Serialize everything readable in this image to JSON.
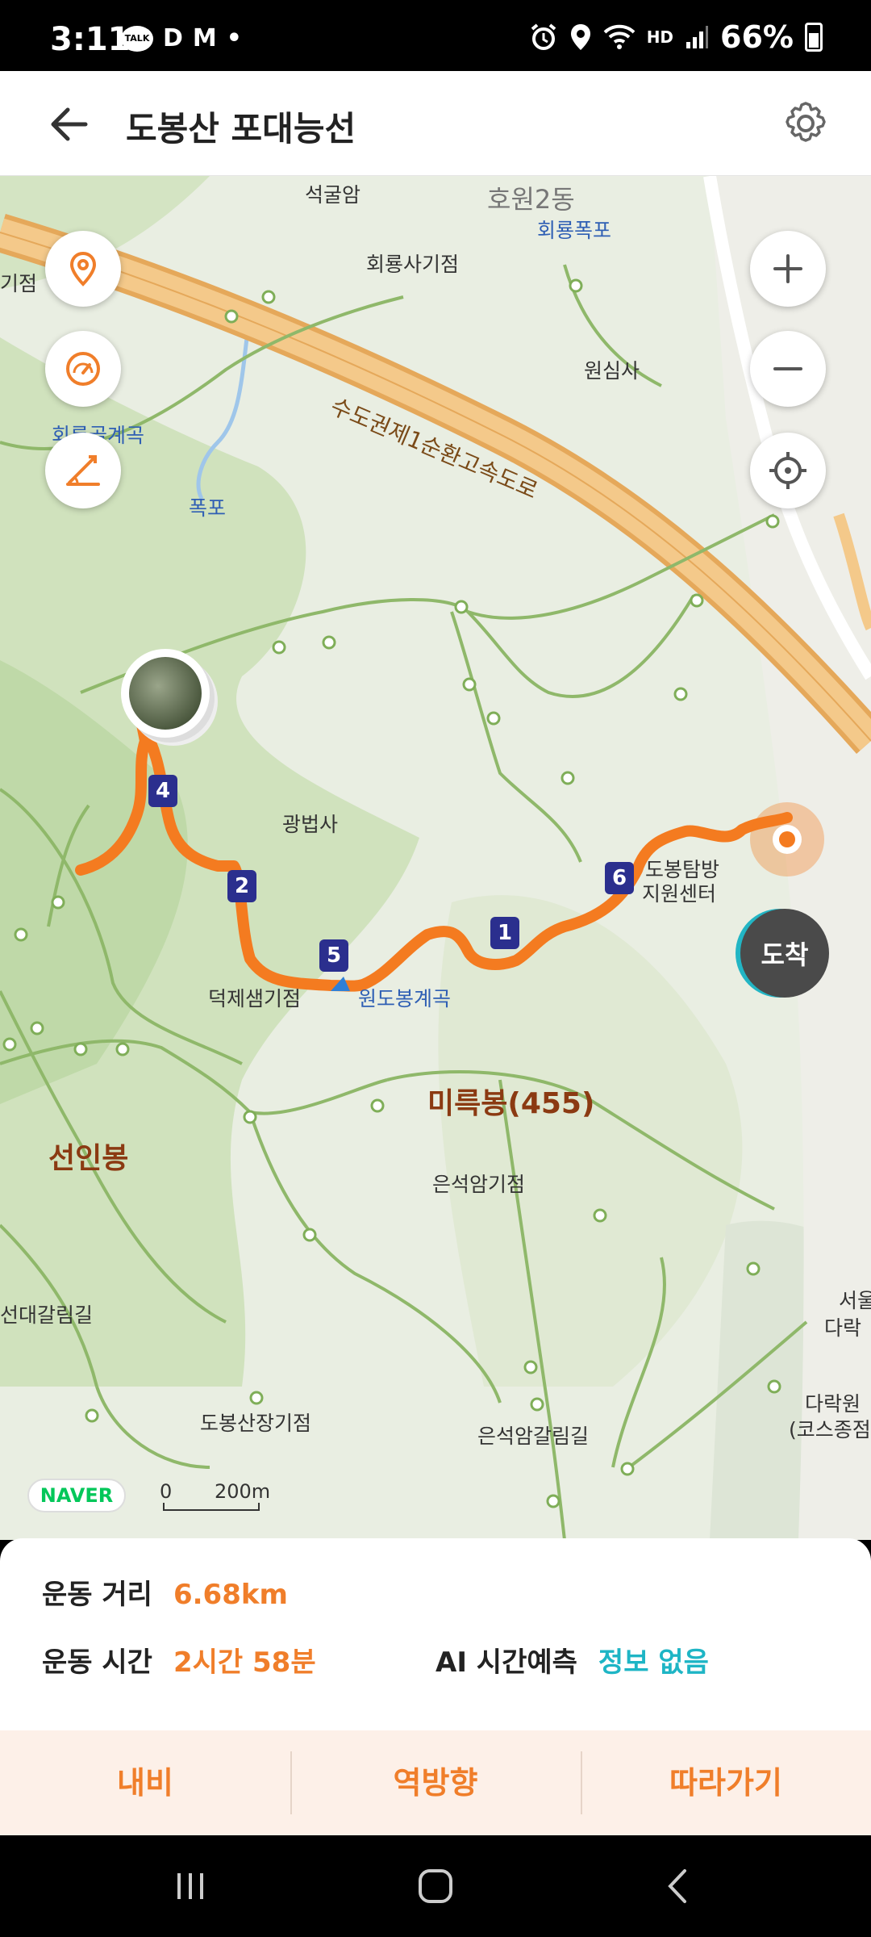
{
  "status_bar": {
    "time": "3:11",
    "notifications": [
      "TALK",
      "D",
      "M",
      "•"
    ],
    "network": "HD",
    "battery": "66%"
  },
  "header": {
    "title": "도봉산 포대능선",
    "back_icon": "arrow-left-icon",
    "settings_icon": "gear-icon"
  },
  "map": {
    "labels": {
      "seokgulam": "석굴암",
      "howon2dong": "호원2동",
      "hoeryong_falls": "회룡폭포",
      "hoeryongsa": "회룡사기점",
      "left_edge": "기점",
      "wonsimsa": "원심사",
      "hoeryong_valley": "회룡골계곡",
      "waterfall": "폭포",
      "expressway": "수도권제1순환고속도로",
      "gwangbeopsa": "광법사",
      "dobong_center_1": "도봉탐방",
      "dobong_center_2": "지원센터",
      "deokje_spring": "덕제샘기점",
      "wondobong_valley": "원도봉계곡",
      "mireukbong": "미륵봉(455)",
      "seoninbong": "선인봉",
      "euneokam_start": "은석암기점",
      "seondaegallim": "선대갈림길",
      "seoul_1": "서울",
      "seoul_2": "다락",
      "darakwon": "다락원",
      "course_end": "(코스종점",
      "dobongsanjang": "도봉산장기점",
      "euneokam_fork": "은석암갈림길"
    },
    "markers": [
      "1",
      "2",
      "4",
      "5",
      "6"
    ],
    "arrive_label": "도착",
    "naver_logo": "NAVER",
    "scale_zero": "0",
    "scale_label": "200m",
    "accent_color": "#f07e2a",
    "route_color": "#f47b20"
  },
  "controls": {
    "location_icon": "location-pin-icon",
    "speedometer_icon": "speedometer-icon",
    "slope_icon": "slope-icon",
    "zoom_in_icon": "plus-icon",
    "zoom_out_icon": "minus-icon",
    "my_location_icon": "crosshair-icon"
  },
  "info": {
    "distance_label": "운동 거리",
    "distance_value": "6.68km",
    "time_label": "운동 시간",
    "time_value": "2시간 58분",
    "ai_label": "AI 시간예측",
    "ai_value": "정보 없음"
  },
  "actions": {
    "navigate": "내비",
    "reverse": "역방향",
    "follow": "따라가기"
  },
  "nav_bar": {
    "recents_icon": "recents-icon",
    "home_icon": "home-icon",
    "back_icon": "back-chevron-icon"
  }
}
